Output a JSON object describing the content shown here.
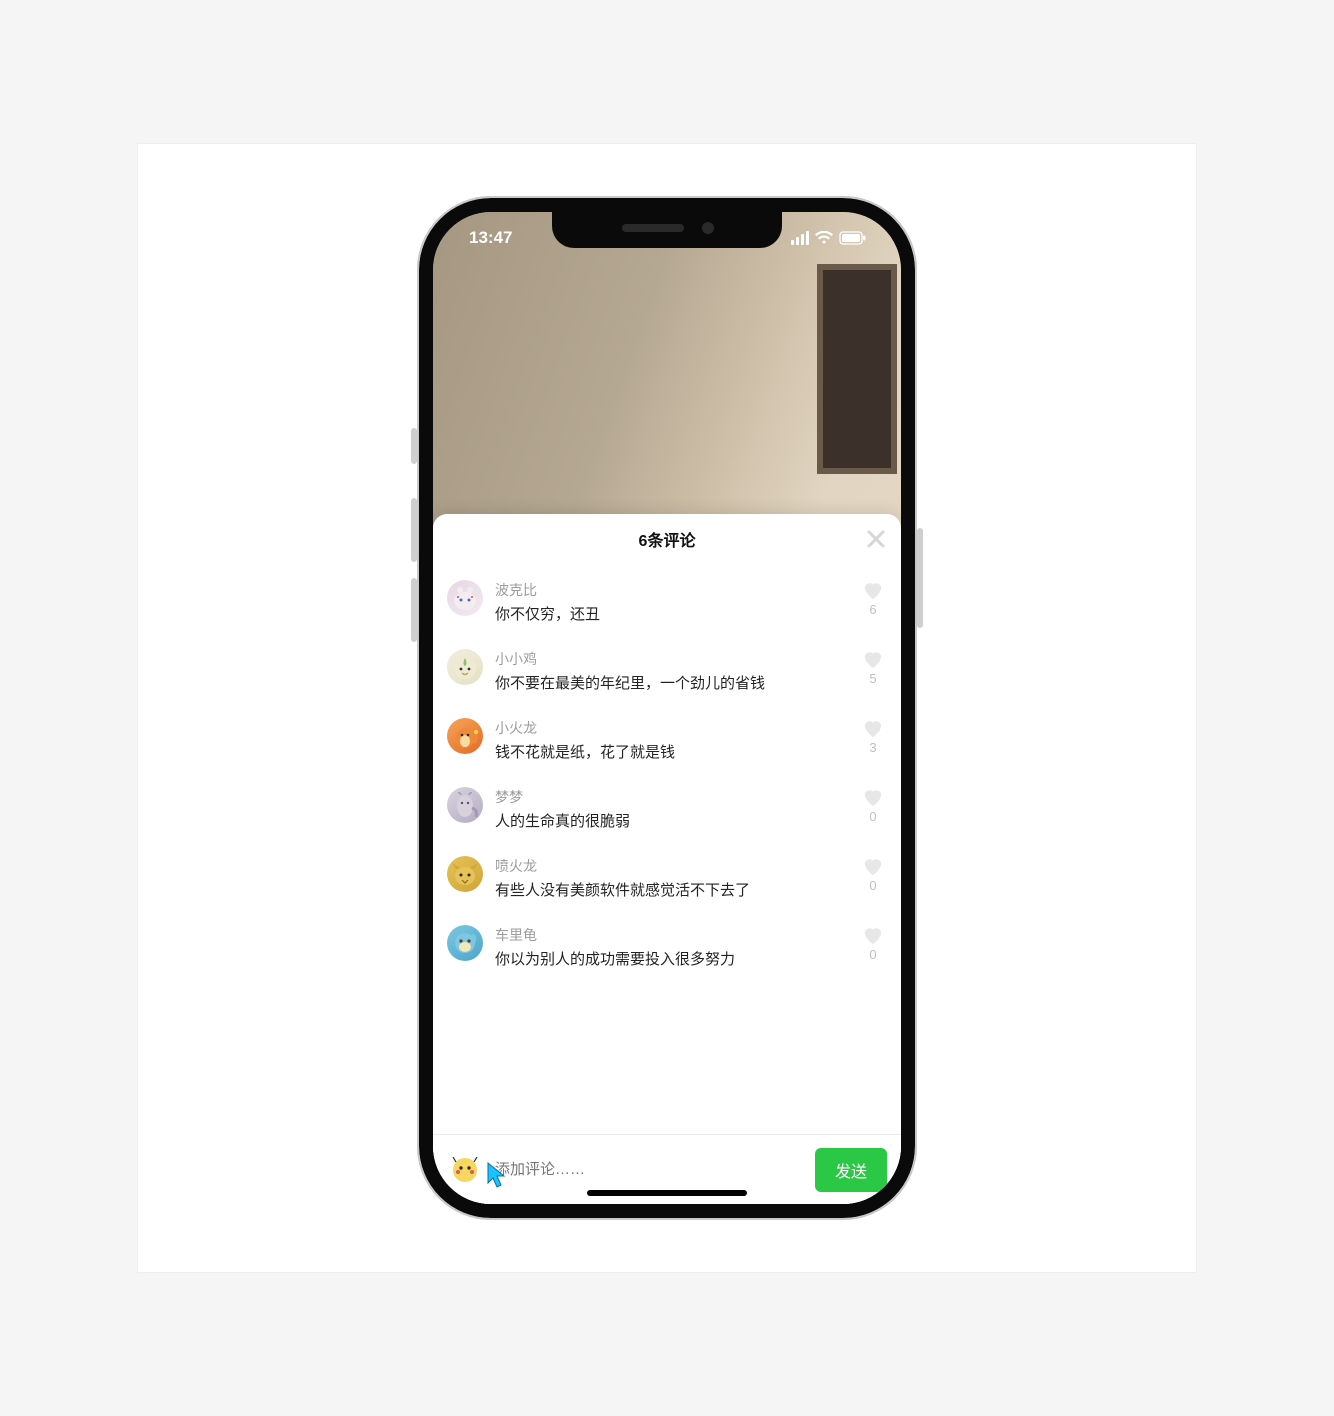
{
  "status": {
    "time": "13:47"
  },
  "sheet": {
    "title": "6条评论"
  },
  "comments": [
    {
      "name": "波克比",
      "text": "你不仅穷，还丑",
      "likes": "6"
    },
    {
      "name": "小小鸡",
      "text": "你不要在最美的年纪里，一个劲儿的省钱",
      "likes": "5"
    },
    {
      "name": "小火龙",
      "text": "钱不花就是纸，花了就是钱",
      "likes": "3"
    },
    {
      "name": "梦梦",
      "text": "人的生命真的很脆弱",
      "likes": "0"
    },
    {
      "name": "喷火龙",
      "text": "有些人没有美颜软件就感觉活不下去了",
      "likes": "0"
    },
    {
      "name": "车里龟",
      "text": "你以为别人的成功需要投入很多努力",
      "likes": "0"
    }
  ],
  "input": {
    "placeholder": "添加评论……",
    "send_label": "发送"
  },
  "avatar_gradients": [
    [
      "#e6d8e4",
      "#f2e9f0"
    ],
    [
      "#f2eedd",
      "#e4e0c6"
    ],
    [
      "#f7a55a",
      "#e46a24"
    ],
    [
      "#d9d4de",
      "#b4acc3"
    ],
    [
      "#e6c257",
      "#cfa537"
    ],
    [
      "#7ec7e2",
      "#4aa6c8"
    ]
  ],
  "my_avatar_gradient": [
    "#f6d760",
    "#e0a82a"
  ]
}
